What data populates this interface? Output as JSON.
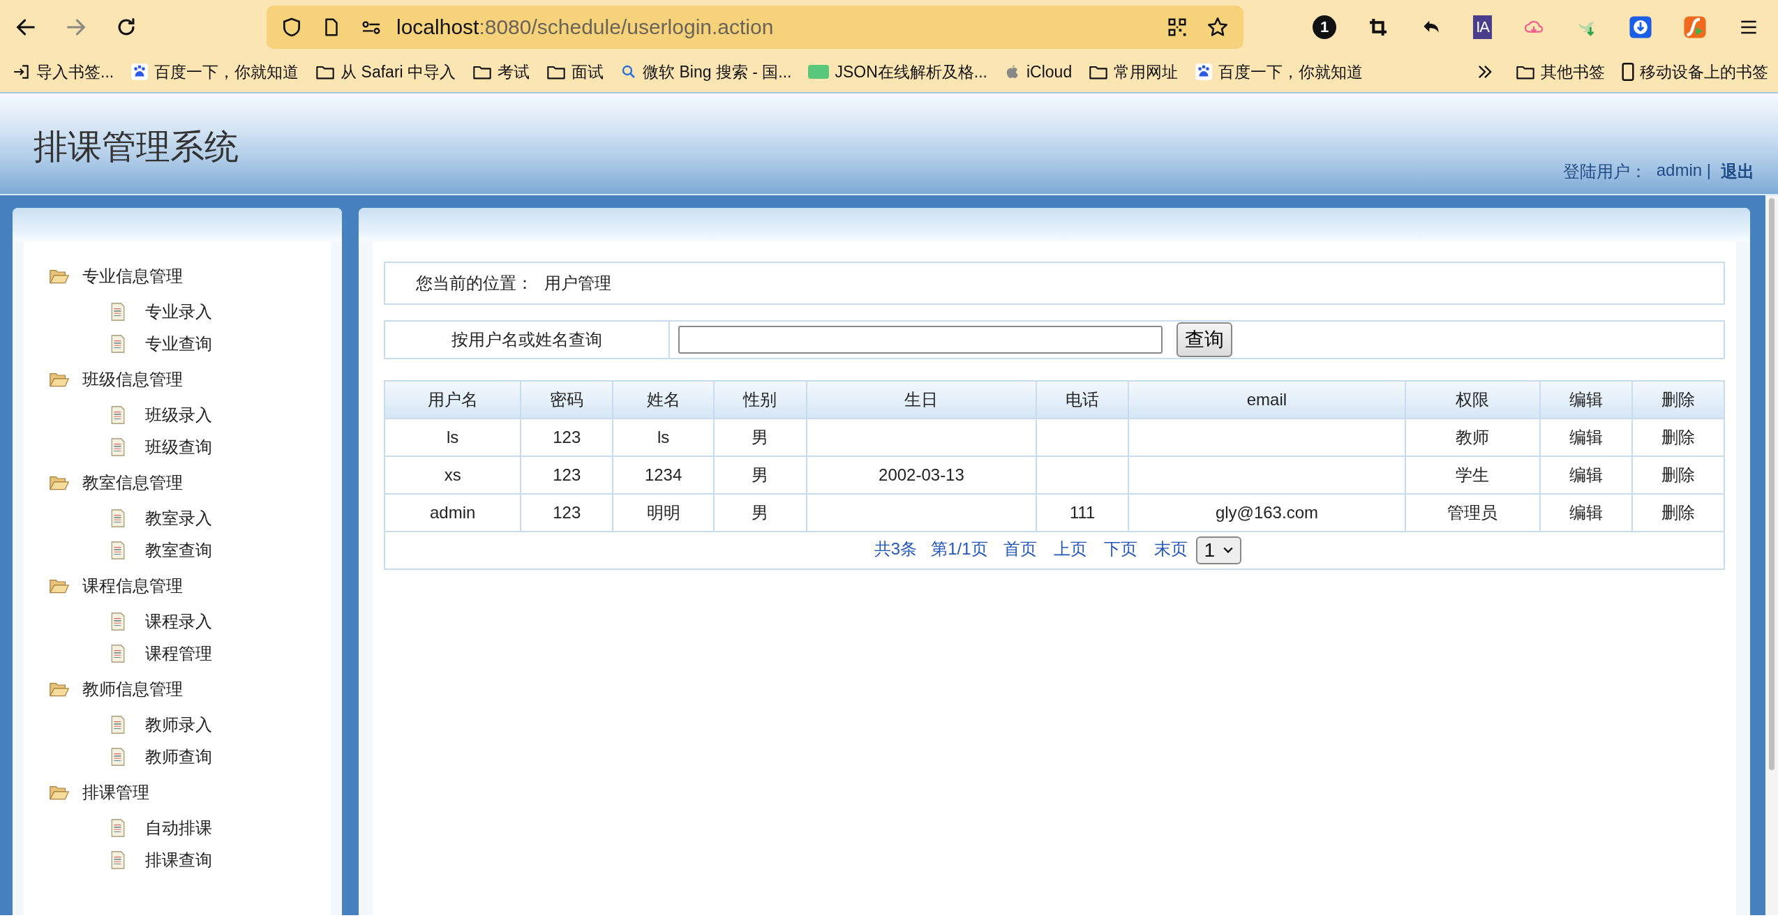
{
  "browser": {
    "nav": [
      {
        "kind": "back",
        "disabled": false
      },
      {
        "kind": "forward",
        "disabled": true
      },
      {
        "kind": "reload",
        "disabled": false
      }
    ],
    "address": {
      "host": "localhost",
      "rest": ":8080/schedule/userlogin.action"
    },
    "toolbar": [
      {
        "kind": "badge",
        "label": "1"
      },
      {
        "kind": "crop"
      },
      {
        "kind": "undo"
      },
      {
        "kind": "ia",
        "label": "IA"
      },
      {
        "kind": "cloud"
      },
      {
        "kind": "bird"
      },
      {
        "kind": "download"
      },
      {
        "kind": "flash"
      },
      {
        "kind": "menu"
      }
    ],
    "bookmarks": [
      {
        "kind": "import",
        "label": "导入书签..."
      },
      {
        "kind": "paw",
        "label": "百度一下，你就知道"
      },
      {
        "kind": "folder",
        "label": "从 Safari 中导入"
      },
      {
        "kind": "folder",
        "label": "考试"
      },
      {
        "kind": "folder",
        "label": "面试"
      },
      {
        "kind": "search",
        "label": "微软 Bing 搜索 - 国..."
      },
      {
        "kind": "json",
        "label": "JSON在线解析及格..."
      },
      {
        "kind": "apple",
        "label": "iCloud"
      },
      {
        "kind": "folder",
        "label": "常用网址"
      },
      {
        "kind": "paw",
        "label": "百度一下，你就知道"
      }
    ],
    "bookmarks_right": [
      {
        "kind": "folder",
        "label": "其他书签"
      },
      {
        "kind": "phone",
        "label": "移动设备上的书签"
      }
    ]
  },
  "header": {
    "title": "排课管理系统",
    "login_label": "登陆用户：",
    "user": "admin |",
    "logout": "退出"
  },
  "sidebar": {
    "groups": [
      {
        "label": "专业信息管理",
        "expanded": true,
        "children": [
          {
            "label": "专业录入"
          },
          {
            "label": "专业查询"
          }
        ]
      },
      {
        "label": "班级信息管理",
        "expanded": true,
        "children": [
          {
            "label": "班级录入"
          },
          {
            "label": "班级查询"
          }
        ]
      },
      {
        "label": "教室信息管理",
        "expanded": true,
        "children": [
          {
            "label": "教室录入"
          },
          {
            "label": "教室查询"
          }
        ]
      },
      {
        "label": "课程信息管理",
        "expanded": true,
        "children": [
          {
            "label": "课程录入"
          },
          {
            "label": "课程管理"
          }
        ]
      },
      {
        "label": "教师信息管理",
        "expanded": true,
        "children": [
          {
            "label": "教师录入"
          },
          {
            "label": "教师查询"
          }
        ]
      },
      {
        "label": "排课管理",
        "expanded": true,
        "children": [
          {
            "label": "自动排课"
          },
          {
            "label": "排课查询"
          }
        ]
      }
    ]
  },
  "breadcrumb": {
    "label": "您当前的位置：",
    "current": "用户管理"
  },
  "search": {
    "label": "按用户名或姓名查询",
    "button": "查询"
  },
  "table": {
    "columns": [
      "用户名",
      "密码",
      "姓名",
      "性别",
      "生日",
      "电话",
      "email",
      "权限",
      "编辑",
      "删除"
    ],
    "rows": [
      {
        "cells": [
          "ls",
          "123",
          "ls",
          "男",
          "",
          "",
          "",
          "教师",
          "编辑",
          "删除"
        ]
      },
      {
        "cells": [
          "xs",
          "123",
          "1234",
          "男",
          "2002-03-13",
          "",
          "",
          "学生",
          "编辑",
          "删除"
        ]
      },
      {
        "cells": [
          "admin",
          "123",
          "明明",
          "男",
          "",
          "111",
          "gly@163.com",
          "管理员",
          "编辑",
          "删除"
        ]
      }
    ]
  },
  "pagination": {
    "summary": "共3条",
    "page": "第1/1页",
    "links": [
      "首页",
      "上页",
      "下页",
      "末页"
    ],
    "select": "1"
  }
}
